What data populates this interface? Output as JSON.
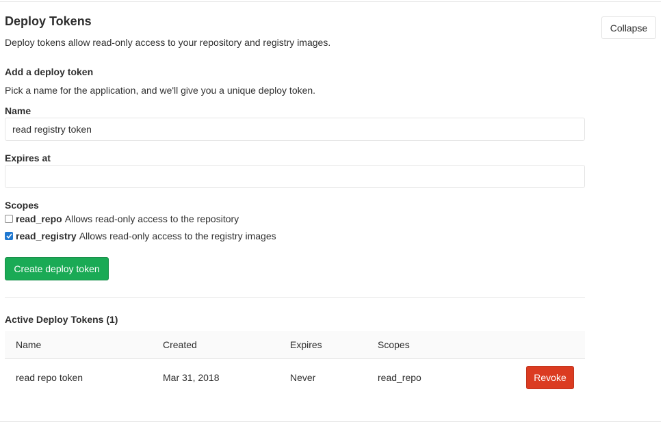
{
  "section": {
    "title": "Deploy Tokens",
    "description": "Deploy tokens allow read-only access to your repository and registry images.",
    "collapse_label": "Collapse"
  },
  "add_form": {
    "heading": "Add a deploy token",
    "intro": "Pick a name for the application, and we'll give you a unique deploy token.",
    "name_label": "Name",
    "name_value": "read registry token",
    "expires_label": "Expires at",
    "expires_value": "",
    "scopes_label": "Scopes",
    "scopes": [
      {
        "name": "read_repo",
        "description": "Allows read-only access to the repository",
        "checked": false
      },
      {
        "name": "read_registry",
        "description": "Allows read-only access to the registry images",
        "checked": true
      }
    ],
    "submit_label": "Create deploy token"
  },
  "active_tokens": {
    "heading": "Active Deploy Tokens (1)",
    "columns": [
      "Name",
      "Created",
      "Expires",
      "Scopes"
    ],
    "rows": [
      {
        "name": "read repo token",
        "created": "Mar 31, 2018",
        "expires": "Never",
        "scopes": "read_repo",
        "action_label": "Revoke"
      }
    ]
  },
  "colors": {
    "create_button": "#1aaa55",
    "revoke_button": "#db3b21",
    "checkbox_checked": "#1f78d1"
  }
}
